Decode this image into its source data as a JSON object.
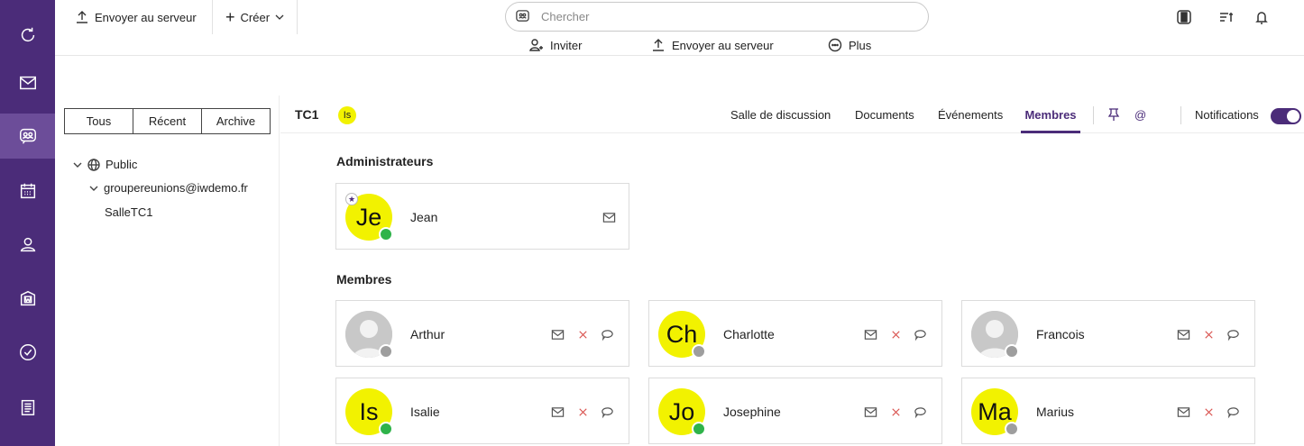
{
  "toolbar": {
    "upload_label": "Envoyer au serveur",
    "create_label": "Créer",
    "search_placeholder": "Chercher"
  },
  "subbar": {
    "invite_label": "Inviter",
    "upload_label": "Envoyer au serveur",
    "more_label": "Plus"
  },
  "leftpanel": {
    "segments": [
      "Tous",
      "Récent",
      "Archive"
    ],
    "tree": {
      "root": "Public",
      "group": "groupereunions@iwdemo.fr",
      "room": "SalleTC1"
    }
  },
  "room": {
    "title": "TC1",
    "badge": "Is",
    "tabs": [
      "Salle de discussion",
      "Documents",
      "Événements",
      "Membres"
    ],
    "active_tab": "Membres",
    "mention_symbol": "@",
    "notifications_label": "Notifications",
    "notifications_on": true
  },
  "admins": {
    "title": "Administrateurs",
    "items": [
      {
        "initials": "Je",
        "name": "Jean",
        "status": "online"
      }
    ]
  },
  "members": {
    "title": "Membres",
    "items": [
      {
        "initials": "",
        "name": "Arthur",
        "status": "offline"
      },
      {
        "initials": "Ch",
        "name": "Charlotte",
        "status": "offline"
      },
      {
        "initials": "",
        "name": "Francois",
        "status": "offline"
      },
      {
        "initials": "Is",
        "name": "Isalie",
        "status": "online"
      },
      {
        "initials": "Jo",
        "name": "Josephine",
        "status": "online"
      },
      {
        "initials": "Ma",
        "name": "Marius",
        "status": "offline"
      }
    ]
  },
  "colors": {
    "brand": "#4b2c79",
    "avatar_bg": "#f2f200",
    "online": "#2fb34a",
    "offline": "#9e9e9e",
    "remove": "#d9534f"
  }
}
